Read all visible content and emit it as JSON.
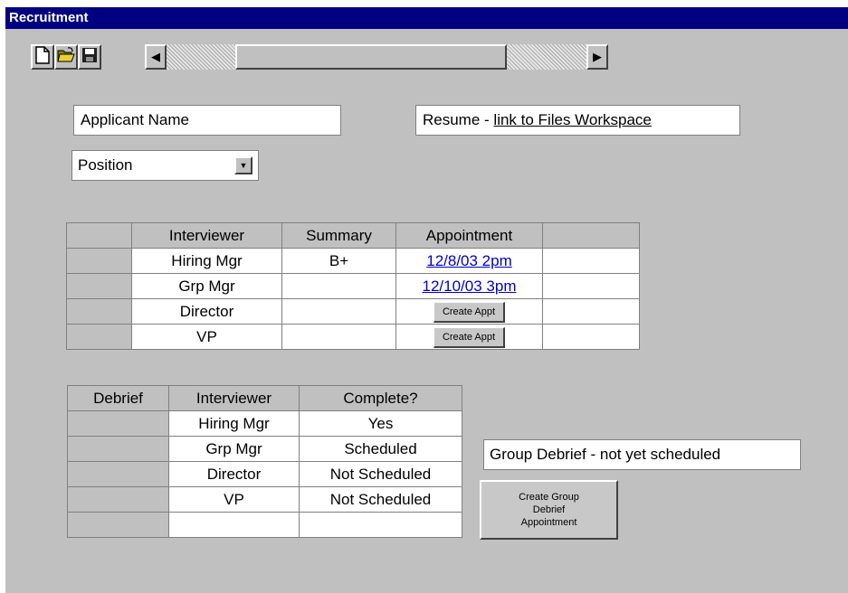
{
  "window": {
    "title": "Recruitment"
  },
  "toolbar": {
    "new_icon": "new-document-icon",
    "open_icon": "open-folder-icon",
    "save_icon": "save-disk-icon",
    "scroll_left": "◀",
    "scroll_right": "▶"
  },
  "form": {
    "applicant_name": "Applicant Name",
    "resume_prefix": "Resume - ",
    "resume_link": "link to Files Workspace",
    "position": "Position",
    "position_arrow": "▼"
  },
  "interviews": {
    "headers": [
      "",
      "Interviewer",
      "Summary",
      "Appointment",
      ""
    ],
    "rows": [
      {
        "interviewer": "Hiring Mgr",
        "summary": "B+",
        "appointment": "12/8/03 2pm"
      },
      {
        "interviewer": "Grp Mgr",
        "summary": "",
        "appointment": "12/10/03 3pm"
      },
      {
        "interviewer": "Director",
        "summary": "",
        "appointment_button": "Create Appt"
      },
      {
        "interviewer": "VP",
        "summary": "",
        "appointment_button": "Create Appt"
      }
    ]
  },
  "debrief": {
    "headers": [
      "Debrief",
      "Interviewer",
      "Complete?"
    ],
    "rows": [
      {
        "interviewer": "Hiring Mgr",
        "complete": "Yes"
      },
      {
        "interviewer": "Grp Mgr",
        "complete": "Scheduled"
      },
      {
        "interviewer": "Director",
        "complete": "Not Scheduled"
      },
      {
        "interviewer": "VP",
        "complete": "Not Scheduled"
      },
      {
        "interviewer": "",
        "complete": ""
      }
    ],
    "group_status": "Group Debrief - not yet scheduled",
    "group_button": "Create Group Debrief Appointment"
  },
  "colors": {
    "titlebar": "#000080",
    "window_bg": "#c0c0c0",
    "link": "#0000cc"
  }
}
